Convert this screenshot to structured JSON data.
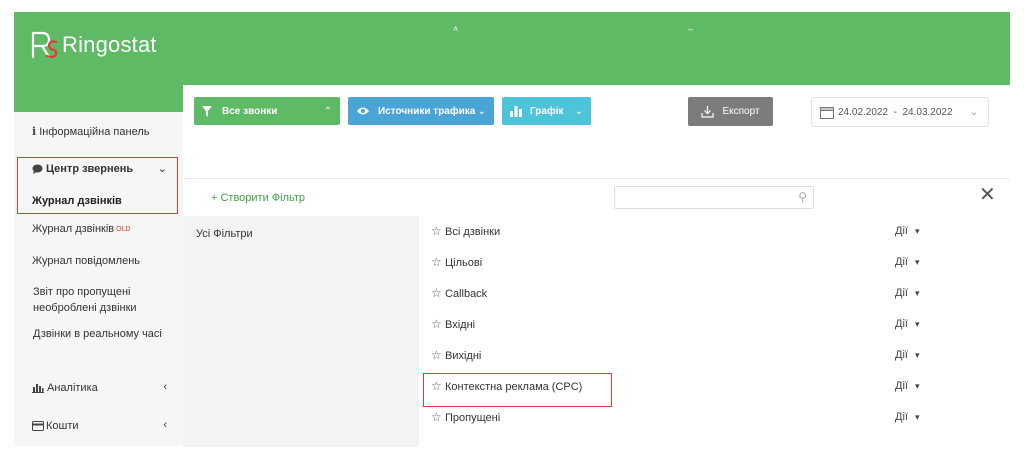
{
  "brand": {
    "name": "Ringostat",
    "color": "#5fba65"
  },
  "sidebar": {
    "dashboard": "Інформаційна панель",
    "call_center": "Центр звернень",
    "call_log": "Журнал дзвінків",
    "call_log_old": "Журнал дзвінків",
    "old_badge": "OLD",
    "message_log": "Журнал повідомлень",
    "missed_report": "Звіт про пропущені необроблені дзвінки",
    "realtime": "Дзвінки в реальному часі",
    "analytics": "Аналітика",
    "funds": "Кошти"
  },
  "toolbar": {
    "all_calls": "Все звонки",
    "traffic_sources": "Источники трафика",
    "graph": "Графік",
    "export": "Експорт",
    "date_range": "24.02.2022  -  24.03.2022"
  },
  "filters": {
    "create": "+ Створити Фільтр",
    "all_filters": "Усі Фільтри",
    "items": [
      {
        "label": "Всі дзвінки",
        "action": "Дії"
      },
      {
        "label": "Цільові",
        "action": "Дії"
      },
      {
        "label": "Callback",
        "action": "Дії"
      },
      {
        "label": "Вхідні",
        "action": "Дії"
      },
      {
        "label": "Вихідні",
        "action": "Дії"
      },
      {
        "label": "Контекстна реклама (CPC)",
        "action": "Дії"
      },
      {
        "label": "Пропущені",
        "action": "Дії"
      }
    ]
  },
  "colors": {
    "highlight": "#e53935",
    "green": "#5fba65",
    "blue": "#4aa5d6",
    "cyan": "#4dc4d9",
    "grey": "#7c7c7c"
  }
}
